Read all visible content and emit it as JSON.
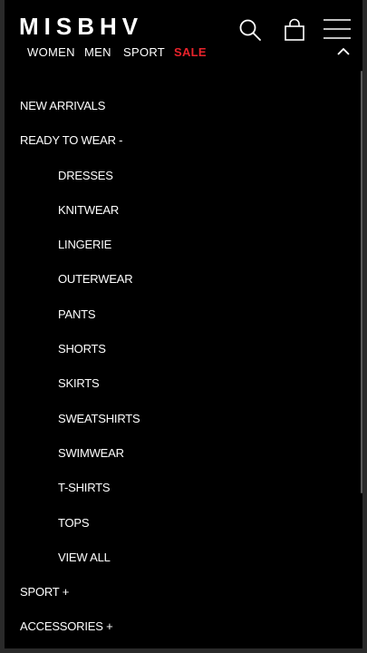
{
  "header": {
    "logo": "MISBHV",
    "icons": [
      "search-icon",
      "shopping-bag-icon",
      "hamburger-menu-icon"
    ]
  },
  "topnav": {
    "women": "WOMEN",
    "men": "MEN",
    "sport": "SPORT",
    "sale": "SALE",
    "sale_color": "#e8232b"
  },
  "menu": {
    "new_arrivals": "NEW ARRIVALS",
    "ready_to_wear": "READY TO WEAR -",
    "subcategories": [
      "DRESSES",
      "KNITWEAR",
      "LINGERIE",
      "OUTERWEAR",
      "PANTS",
      "SHORTS",
      "SKIRTS",
      "SWEATSHIRTS",
      "SWIMWEAR",
      "T-SHIRTS",
      "TOPS",
      "VIEW ALL"
    ],
    "sport": "SPORT +",
    "accessories": "ACCESSORIES +"
  },
  "colors": {
    "background": "#000000",
    "text": "#ffffff",
    "accent_sale": "#e8232b"
  }
}
